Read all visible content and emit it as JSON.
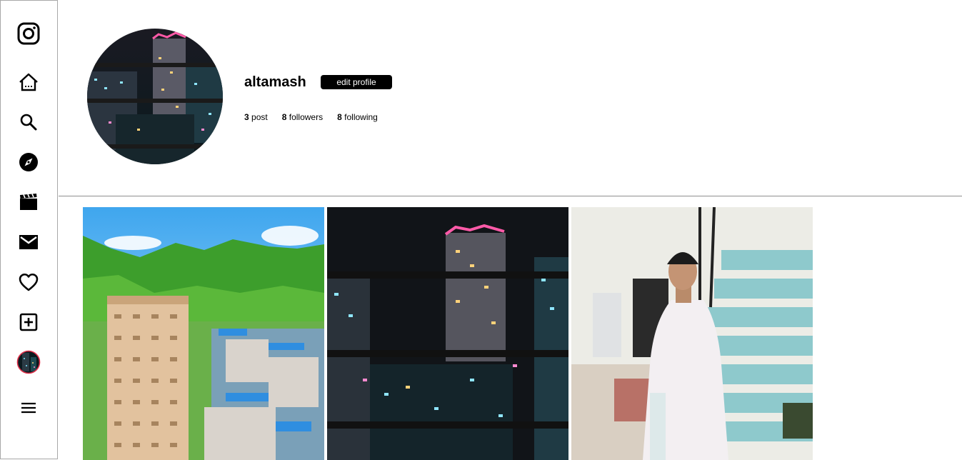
{
  "sidebar": {
    "items": [
      {
        "name": "instagram-logo",
        "icon": "instagram-icon"
      },
      {
        "name": "home",
        "icon": "home-icon"
      },
      {
        "name": "search",
        "icon": "search-icon"
      },
      {
        "name": "explore",
        "icon": "compass-icon"
      },
      {
        "name": "reels",
        "icon": "clapperboard-icon"
      },
      {
        "name": "messages",
        "icon": "mail-icon"
      },
      {
        "name": "notifications",
        "icon": "heart-icon"
      },
      {
        "name": "create",
        "icon": "plus-square-icon"
      },
      {
        "name": "profile",
        "icon": "avatar"
      },
      {
        "name": "more",
        "icon": "menu-icon"
      }
    ]
  },
  "profile": {
    "username": "altamash",
    "edit_button_label": "edit profile",
    "stats": {
      "posts_count": "3",
      "posts_label": "post",
      "followers_count": "8",
      "followers_label": "followers",
      "following_count": "8",
      "following_label": "following"
    }
  },
  "posts": [
    {
      "name": "post-mountain-city"
    },
    {
      "name": "post-night-city"
    },
    {
      "name": "post-man-stairs"
    }
  ],
  "colors": {
    "sidebar_border": "#a8a8a8",
    "divider": "#8e8e8e",
    "button_bg": "#000000",
    "button_text": "#ffffff"
  }
}
